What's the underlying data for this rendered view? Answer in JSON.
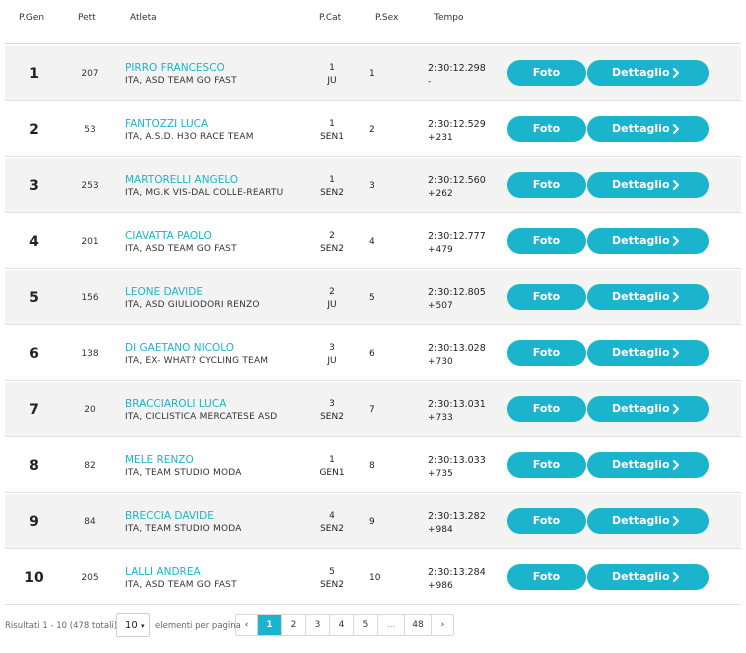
{
  "header": {
    "pgen": "P.Gen",
    "pett": "Pett",
    "atleta": "Atleta",
    "pcat": "P.Cat",
    "psex": "P.Sex",
    "tempo": "Tempo"
  },
  "buttons": {
    "foto": "Foto",
    "dettaglio": "Dettaglio"
  },
  "rows": [
    {
      "pos": "1",
      "bib": "207",
      "name": "PIRRO FRANCESCO",
      "team": "ITA, ASD TEAM GO FAST",
      "cat_pos": "1",
      "cat": "JU",
      "sex_pos": "1",
      "time": "2:30:12.298",
      "gap": "-"
    },
    {
      "pos": "2",
      "bib": "53",
      "name": "FANTOZZI LUCA",
      "team": "ITA, A.S.D. H3O RACE TEAM",
      "cat_pos": "1",
      "cat": "SEN1",
      "sex_pos": "2",
      "time": "2:30:12.529",
      "gap": "+231"
    },
    {
      "pos": "3",
      "bib": "253",
      "name": "MARTORELLI ANGELO",
      "team": "ITA, MG.K VIS-DAL COLLE-REARTU",
      "cat_pos": "1",
      "cat": "SEN2",
      "sex_pos": "3",
      "time": "2:30:12.560",
      "gap": "+262"
    },
    {
      "pos": "4",
      "bib": "201",
      "name": "CIAVATTA PAOLO",
      "team": "ITA, ASD TEAM GO FAST",
      "cat_pos": "2",
      "cat": "SEN2",
      "sex_pos": "4",
      "time": "2:30:12.777",
      "gap": "+479"
    },
    {
      "pos": "5",
      "bib": "156",
      "name": "LEONE DAVIDE",
      "team": "ITA, ASD GIULIODORI RENZO",
      "cat_pos": "2",
      "cat": "JU",
      "sex_pos": "5",
      "time": "2:30:12.805",
      "gap": "+507"
    },
    {
      "pos": "6",
      "bib": "138",
      "name": "DI GAETANO NICOLO",
      "team": "ITA, EX- WHAT? CYCLING TEAM",
      "cat_pos": "3",
      "cat": "JU",
      "sex_pos": "6",
      "time": "2:30:13.028",
      "gap": "+730"
    },
    {
      "pos": "7",
      "bib": "20",
      "name": "BRACCIAROLI LUCA",
      "team": "ITA, CICLISTICA MERCATESE ASD",
      "cat_pos": "3",
      "cat": "SEN2",
      "sex_pos": "7",
      "time": "2:30:13.031",
      "gap": "+733"
    },
    {
      "pos": "8",
      "bib": "82",
      "name": "MELE RENZO",
      "team": "ITA, TEAM STUDIO MODA",
      "cat_pos": "1",
      "cat": "GEN1",
      "sex_pos": "8",
      "time": "2:30:13.033",
      "gap": "+735"
    },
    {
      "pos": "9",
      "bib": "84",
      "name": "BRECCIA DAVIDE",
      "team": "ITA, TEAM STUDIO MODA",
      "cat_pos": "4",
      "cat": "SEN2",
      "sex_pos": "9",
      "time": "2:30:13.282",
      "gap": "+984"
    },
    {
      "pos": "10",
      "bib": "205",
      "name": "LALLI ANDREA",
      "team": "ITA, ASD TEAM GO FAST",
      "cat_pos": "5",
      "cat": "SEN2",
      "sex_pos": "10",
      "time": "2:30:13.284",
      "gap": "+986"
    }
  ],
  "footer": {
    "results_text": "Risultati 1 - 10 (478 totali)",
    "per_page_value": "10",
    "per_page_label": "elementi per pagina",
    "pages": [
      "‹",
      "1",
      "2",
      "3",
      "4",
      "5",
      "...",
      "48",
      "›"
    ],
    "active_page": "1"
  },
  "colors": {
    "accent": "#1bb4cd",
    "row_alt": "#f3f3f3"
  },
  "icons": {
    "button_chevron": "chevron-right-icon",
    "select_arrow": "caret-down-icon"
  }
}
